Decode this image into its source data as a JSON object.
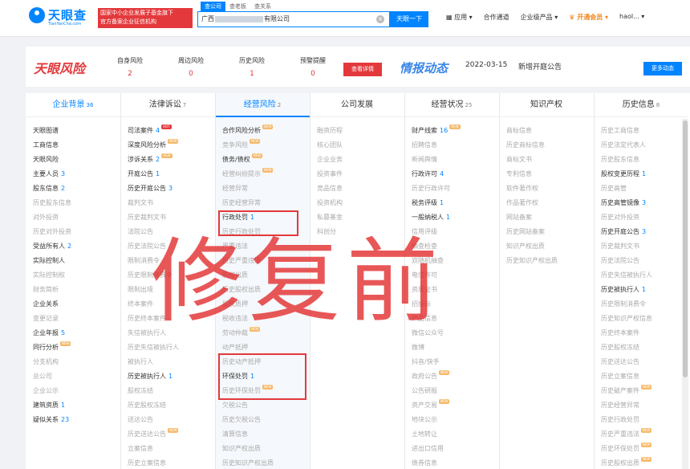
{
  "header": {
    "logo": "天眼查",
    "logo_sub": "TianYanCha.com",
    "badge_line1": "国家中小企业发展子基金旗下",
    "badge_line2": "官方备案企业征信机构",
    "search_tabs": [
      "查公司",
      "查老板",
      "查关系"
    ],
    "search_prefix": "广西",
    "search_suffix": "有限公司",
    "search_button": "天眼一下",
    "nav": [
      "应用",
      "合作通道",
      "企业级产品",
      "开通会员",
      "haol..."
    ]
  },
  "risk": {
    "logo": "天眼风险",
    "items": [
      {
        "label": "自身风险",
        "value": "2"
      },
      {
        "label": "周边风险",
        "value": "0"
      },
      {
        "label": "历史风险",
        "value": "1"
      },
      {
        "label": "预警提醒",
        "value": "0"
      }
    ],
    "detail_button": "查看详情",
    "intel_title": "情报动态",
    "intel_date": "2022-03-15",
    "intel_text": "新增开庭公告",
    "more_button": "更多动态"
  },
  "columns": [
    {
      "title": "企业背景",
      "count": "36",
      "items": [
        {
          "t": "天眼图谱"
        },
        {
          "t": "工商信息"
        },
        {
          "t": "天眼风险"
        },
        {
          "t": "主要人员",
          "n": "3"
        },
        {
          "t": "股东信息",
          "n": "2"
        },
        {
          "t": "历史股东信息",
          "g": true
        },
        {
          "t": "对外投资",
          "g": true
        },
        {
          "t": "历史对外投资",
          "g": true
        },
        {
          "t": "受益所有人",
          "n": "2"
        },
        {
          "t": "实际控制人"
        },
        {
          "t": "实际控制权",
          "g": true
        },
        {
          "t": "财务简析",
          "g": true
        },
        {
          "t": "企业关系"
        },
        {
          "t": "变更记录",
          "g": true
        },
        {
          "t": "企业年报",
          "n": "5"
        },
        {
          "t": "同行分析",
          "tag": "NEW"
        },
        {
          "t": "分支机构",
          "g": true
        },
        {
          "t": "总公司",
          "g": true
        },
        {
          "t": "企业公示",
          "g": true
        },
        {
          "t": "建筑资质",
          "n": "1"
        },
        {
          "t": "疑似关系",
          "n": "23"
        }
      ]
    },
    {
      "title": "法律诉讼",
      "count": "7",
      "items": [
        {
          "t": "司法案件",
          "n": "4",
          "tag": "HOT"
        },
        {
          "t": "深度风险分析",
          "tag": "NEW"
        },
        {
          "t": "涉诉关系",
          "n": "2",
          "tag": "NEW"
        },
        {
          "t": "开庭公告",
          "n": "1"
        },
        {
          "t": "历史开庭公告",
          "n": "3"
        },
        {
          "t": "裁判文书",
          "g": true
        },
        {
          "t": "历史裁判文书",
          "g": true
        },
        {
          "t": "法院公告",
          "g": true
        },
        {
          "t": "历史法院公告",
          "g": true
        },
        {
          "t": "限制消费令",
          "g": true
        },
        {
          "t": "历史限制消费令",
          "g": true
        },
        {
          "t": "限制出境",
          "g": true
        },
        {
          "t": "终本案件",
          "g": true
        },
        {
          "t": "历史终本案件",
          "g": true
        },
        {
          "t": "失信被执行人",
          "g": true
        },
        {
          "t": "历史失信被执行人",
          "g": true
        },
        {
          "t": "被执行人",
          "g": true
        },
        {
          "t": "历史被执行人",
          "n": "1"
        },
        {
          "t": "股权冻结",
          "g": true
        },
        {
          "t": "历史股权冻结",
          "g": true
        },
        {
          "t": "送达公告",
          "g": true
        },
        {
          "t": "历史送达公告",
          "g": true,
          "tag": "NEW"
        },
        {
          "t": "立案信息",
          "g": true
        },
        {
          "t": "历史立案信息",
          "g": true
        }
      ]
    },
    {
      "title": "经营风险",
      "count": "2",
      "items": [
        {
          "t": "合作风险分析",
          "tag": "NEW"
        },
        {
          "t": "竞争风险",
          "g": true,
          "tag": "NEW"
        },
        {
          "t": "债务/债权",
          "tag": "NEW"
        },
        {
          "t": "经营纠纷提示",
          "g": true,
          "tag": "NEW"
        },
        {
          "t": "经营异常",
          "g": true
        },
        {
          "t": "历史经营异常",
          "g": true
        },
        {
          "t": "行政处罚",
          "n": "1"
        },
        {
          "t": "历史行政处罚",
          "g": true
        },
        {
          "t": "严重违法",
          "g": true
        },
        {
          "t": "历史严重违法",
          "g": true
        },
        {
          "t": "股权出质",
          "g": true
        },
        {
          "t": "历史股权出质",
          "g": true
        },
        {
          "t": "股权质押",
          "g": true
        },
        {
          "t": "税收违法",
          "g": true
        },
        {
          "t": "劳动仲裁",
          "g": true,
          "tag": "NEW"
        },
        {
          "t": "动产抵押",
          "g": true
        },
        {
          "t": "历史动产抵押",
          "g": true
        },
        {
          "t": "环保处罚",
          "n": "1"
        },
        {
          "t": "历史环保处罚",
          "g": true,
          "tag": "NEW"
        },
        {
          "t": "欠税公告",
          "g": true
        },
        {
          "t": "历史欠税公告",
          "g": true
        },
        {
          "t": "清算信息",
          "g": true
        },
        {
          "t": "知识产权出质",
          "g": true
        },
        {
          "t": "历史知识产权出质",
          "g": true
        }
      ]
    },
    {
      "title": "公司发展",
      "count": "",
      "items": [
        {
          "t": "融资历程",
          "g": true
        },
        {
          "t": "核心团队",
          "g": true
        },
        {
          "t": "企业业务",
          "g": true
        },
        {
          "t": "投资事件",
          "g": true
        },
        {
          "t": "竞品信息",
          "g": true
        },
        {
          "t": "投资机构",
          "g": true
        },
        {
          "t": "私募基金",
          "g": true
        },
        {
          "t": "科创分",
          "g": true
        }
      ]
    },
    {
      "title": "经营状况",
      "count": "25",
      "items": [
        {
          "t": "财产线索",
          "n": "16",
          "tag": "NEW"
        },
        {
          "t": "招聘信息",
          "g": true
        },
        {
          "t": "新闻舆情",
          "g": true
        },
        {
          "t": "行政许可",
          "n": "4"
        },
        {
          "t": "历史行政许可",
          "g": true
        },
        {
          "t": "税务评级",
          "n": "1"
        },
        {
          "t": "一般纳税人",
          "n": "1"
        },
        {
          "t": "信用评级",
          "g": true
        },
        {
          "t": "抽查检查",
          "g": true
        },
        {
          "t": "双随机抽查",
          "g": true
        },
        {
          "t": "电信许可",
          "g": true
        },
        {
          "t": "资质证书",
          "g": true
        },
        {
          "t": "招投标",
          "g": true
        },
        {
          "t": "产品信息",
          "g": true
        },
        {
          "t": "微信公众号",
          "g": true
        },
        {
          "t": "微博",
          "g": true
        },
        {
          "t": "抖音/快手",
          "g": true
        },
        {
          "t": "政府公告",
          "g": true,
          "tag": "NEW"
        },
        {
          "t": "公告研报",
          "g": true
        },
        {
          "t": "资产交易",
          "g": true,
          "tag": "NEW"
        },
        {
          "t": "地块公示",
          "g": true
        },
        {
          "t": "土地转让",
          "g": true
        },
        {
          "t": "进出口信用",
          "g": true
        },
        {
          "t": "债券信息",
          "g": true
        }
      ]
    },
    {
      "title": "知识产权",
      "count": "",
      "items": [
        {
          "t": "商标信息",
          "g": true
        },
        {
          "t": "历史商标信息",
          "g": true
        },
        {
          "t": "商标文书",
          "g": true
        },
        {
          "t": "专利信息",
          "g": true
        },
        {
          "t": "软件著作权",
          "g": true
        },
        {
          "t": "作品著作权",
          "g": true
        },
        {
          "t": "网站备案",
          "g": true
        },
        {
          "t": "历史网站备案",
          "g": true
        },
        {
          "t": "知识产权出质",
          "g": true
        },
        {
          "t": "历史知识产权出质",
          "g": true
        }
      ]
    },
    {
      "title": "历史信息",
      "count": "8",
      "items": [
        {
          "t": "历史工商信息",
          "g": true
        },
        {
          "t": "历史法定代表人",
          "g": true
        },
        {
          "t": "历史股东信息",
          "g": true
        },
        {
          "t": "股权变更历程",
          "n": "1"
        },
        {
          "t": "历史高管",
          "g": true
        },
        {
          "t": "历史高管镜像",
          "n": "3"
        },
        {
          "t": "历史对外投资",
          "g": true
        },
        {
          "t": "历史开庭公告",
          "n": "3"
        },
        {
          "t": "历史裁判文书",
          "g": true
        },
        {
          "t": "历史法院公告",
          "g": true
        },
        {
          "t": "历史失信被执行人",
          "g": true
        },
        {
          "t": "历史被执行人",
          "n": "1"
        },
        {
          "t": "历史限制消费令",
          "g": true
        },
        {
          "t": "历史知识产权信息",
          "g": true
        },
        {
          "t": "历史终本案件",
          "g": true
        },
        {
          "t": "历史股权冻结",
          "g": true
        },
        {
          "t": "历史送达公告",
          "g": true
        },
        {
          "t": "历史立案信息",
          "g": true
        },
        {
          "t": "历史破产案件",
          "g": true,
          "tag": "NEW"
        },
        {
          "t": "历史经营异常",
          "g": true
        },
        {
          "t": "历史行政处罚",
          "g": true
        },
        {
          "t": "历史严重违法",
          "g": true,
          "tag": "NEW"
        },
        {
          "t": "历史环保处罚",
          "g": true,
          "tag": "NEW"
        },
        {
          "t": "历史股权出质",
          "g": true,
          "tag": "NEW"
        }
      ]
    }
  ],
  "watermark": "修复前",
  "colors": {
    "brand": "#0084ff",
    "risk": "#e4393c"
  }
}
